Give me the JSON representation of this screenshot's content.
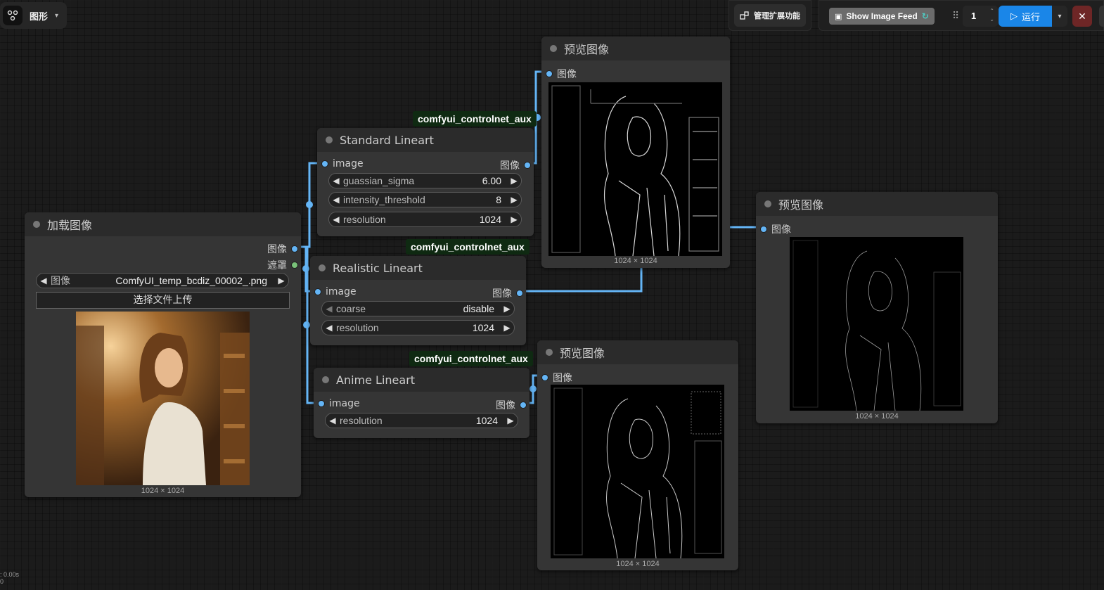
{
  "topbar": {
    "workflow_label": "图形",
    "extensions_label": "管理扩展功能",
    "image_feed_label": "Show Image Feed",
    "queue_count": "1",
    "run_label": "运行"
  },
  "nodes": {
    "load_image": {
      "title": "加载图像",
      "out_image": "图像",
      "out_mask": "遮罩",
      "widget_name": "图像",
      "widget_value": "ComfyUI_temp_bcdiz_00002_.png",
      "upload_label": "选择文件上传",
      "size": "1024 × 1024"
    },
    "standard_lineart": {
      "title": "Standard Lineart",
      "badge": "comfyui_controlnet_aux",
      "in_image": "image",
      "out_image": "图像",
      "widgets": [
        {
          "name": "guassian_sigma",
          "value": "6.00"
        },
        {
          "name": "intensity_threshold",
          "value": "8"
        },
        {
          "name": "resolution",
          "value": "1024"
        }
      ]
    },
    "realistic_lineart": {
      "title": "Realistic Lineart",
      "badge": "comfyui_controlnet_aux",
      "in_image": "image",
      "out_image": "图像",
      "widgets": [
        {
          "name": "coarse",
          "value": "disable"
        },
        {
          "name": "resolution",
          "value": "1024"
        }
      ]
    },
    "anime_lineart": {
      "title": "Anime Lineart",
      "badge": "comfyui_controlnet_aux",
      "in_image": "image",
      "out_image": "图像",
      "widgets": [
        {
          "name": "resolution",
          "value": "1024"
        }
      ]
    },
    "preview_1": {
      "title": "预览图像",
      "in_image": "图像",
      "size": "1024 × 1024"
    },
    "preview_2": {
      "title": "预览图像",
      "in_image": "图像",
      "size": "1024 × 1024"
    },
    "preview_3": {
      "title": "预览图像",
      "in_image": "图像",
      "size": "1024 × 1024"
    }
  },
  "stats": {
    "line1": ": 0.00s",
    "line2": "0"
  },
  "colors": {
    "link": "#64b5f6",
    "mask_pin": "#7ac27a",
    "run": "#1a86e8",
    "badge_bg": "#0f2a12"
  }
}
